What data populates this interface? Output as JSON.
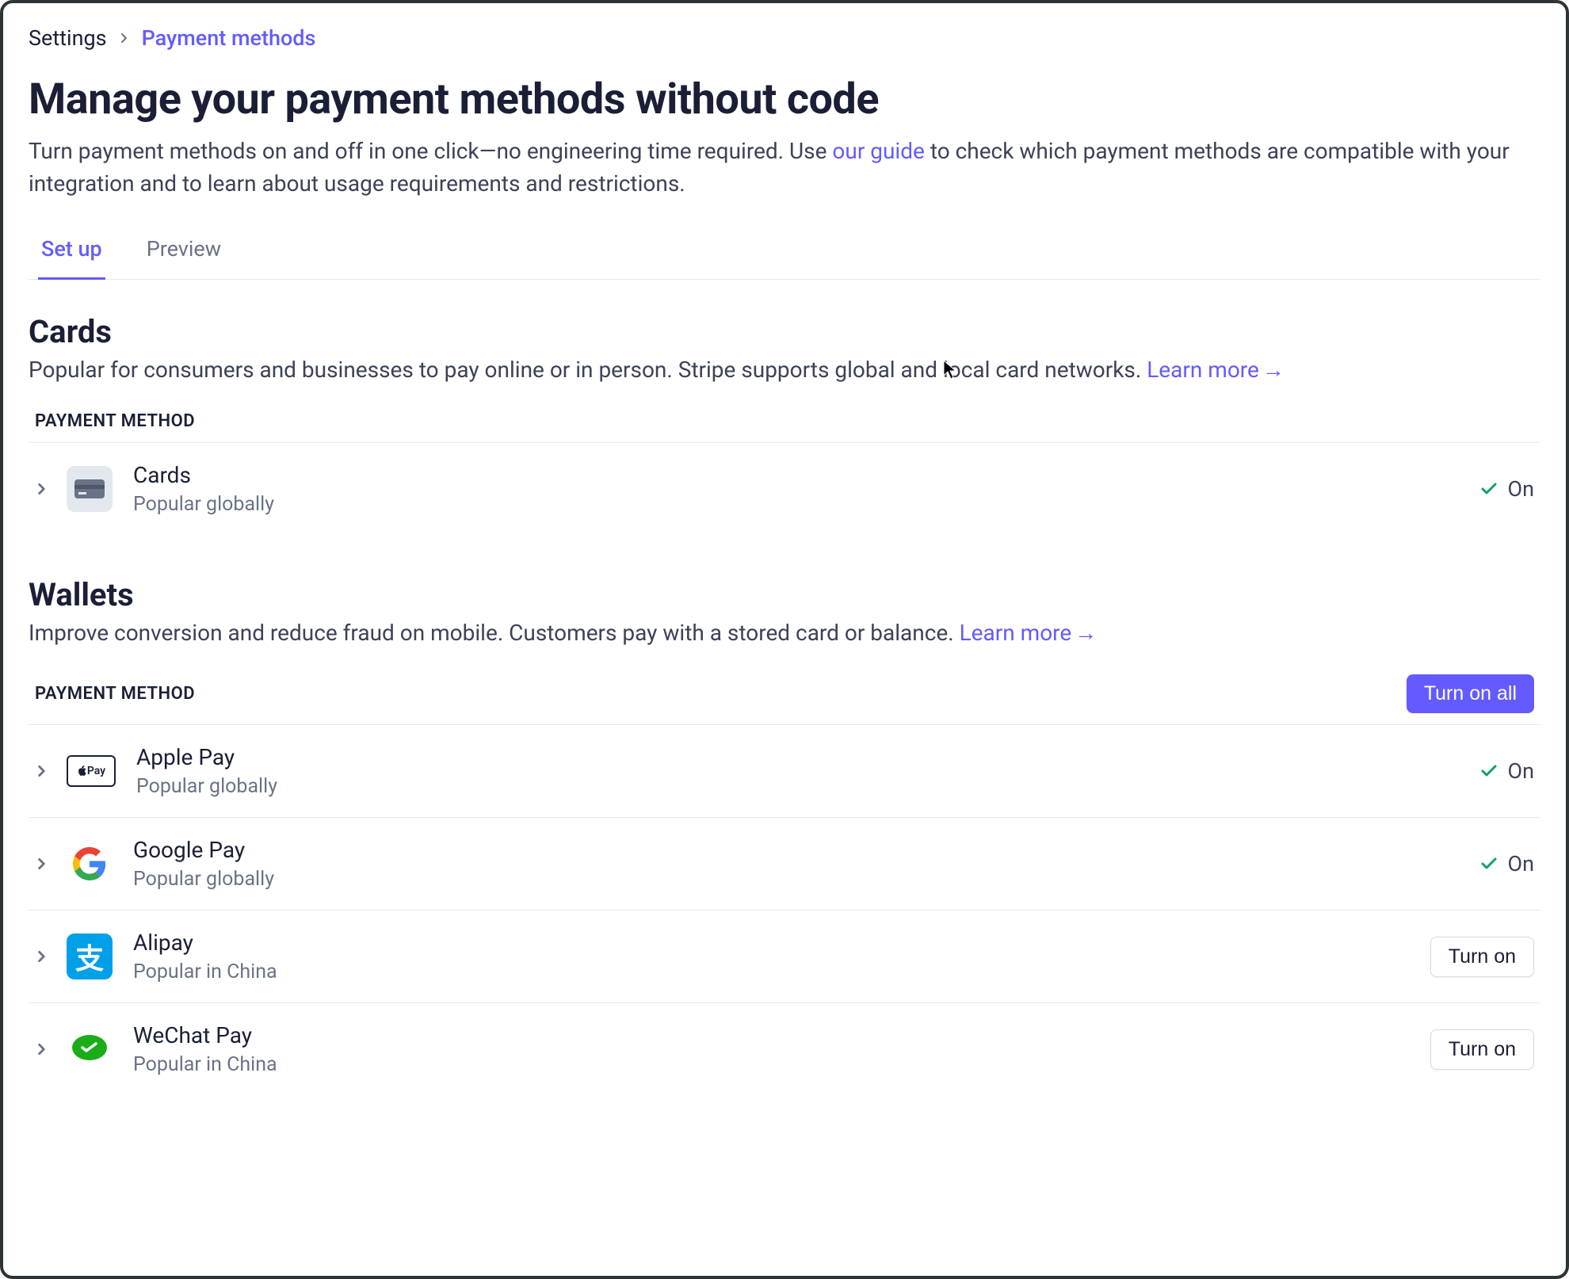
{
  "breadcrumb": {
    "parent": "Settings",
    "current": "Payment methods"
  },
  "header": {
    "title": "Manage your payment methods without code",
    "subtitle_before": "Turn payment methods on and off in one click—no engineering time required. Use ",
    "subtitle_link": "our guide",
    "subtitle_after": " to check which payment methods are compatible with your integration and to learn about usage requirements and restrictions."
  },
  "tabs": {
    "setup": "Set up",
    "preview": "Preview"
  },
  "table_header_label": "PAYMENT METHOD",
  "turn_on_all_label": "Turn on all",
  "turn_on_label": "Turn on",
  "on_label": "On",
  "learn_more_label": "Learn more",
  "sections": {
    "cards": {
      "title": "Cards",
      "subtitle": "Popular for consumers and businesses to pay online or in person. Stripe supports global and local card networks. ",
      "methods": [
        {
          "name": "Cards",
          "desc": "Popular globally",
          "status": "on",
          "icon": "cards"
        }
      ]
    },
    "wallets": {
      "title": "Wallets",
      "subtitle": "Improve conversion and reduce fraud on mobile. Customers pay with a stored card or balance. ",
      "methods": [
        {
          "name": "Apple Pay",
          "desc": "Popular globally",
          "status": "on",
          "icon": "apple"
        },
        {
          "name": "Google Pay",
          "desc": "Popular globally",
          "status": "on",
          "icon": "google"
        },
        {
          "name": "Alipay",
          "desc": "Popular in China",
          "status": "off",
          "icon": "alipay"
        },
        {
          "name": "WeChat Pay",
          "desc": "Popular in China",
          "status": "off",
          "icon": "wechat"
        }
      ]
    }
  }
}
